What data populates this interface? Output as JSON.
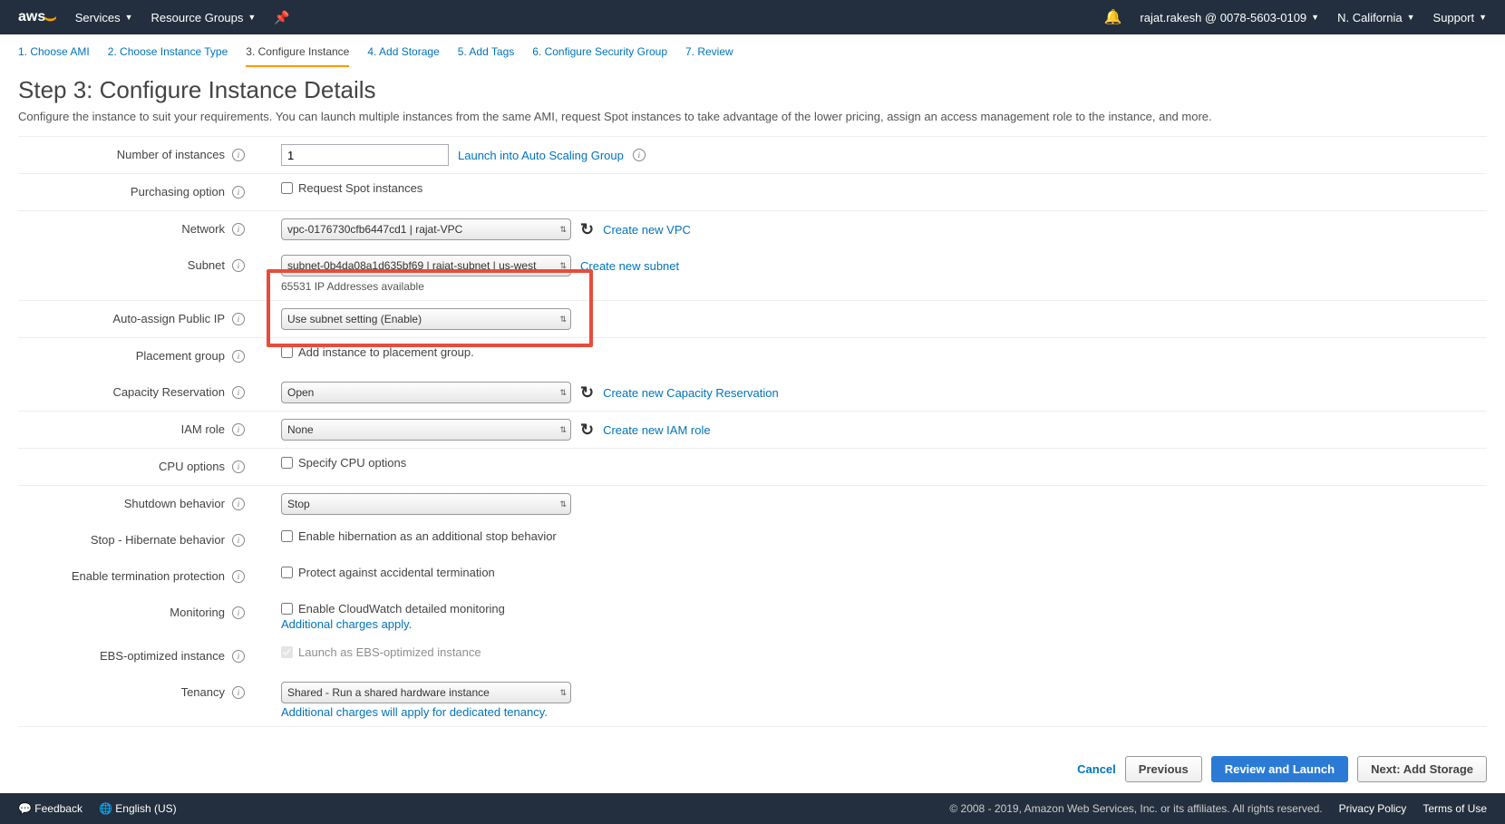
{
  "topnav": {
    "logo_text": "aws",
    "services": "Services",
    "resource_groups": "Resource Groups",
    "account": "rajat.rakesh @ 0078-5603-0109",
    "region": "N. California",
    "support": "Support"
  },
  "wizard": {
    "step1": "1. Choose AMI",
    "step2": "2. Choose Instance Type",
    "step3": "3. Configure Instance",
    "step4": "4. Add Storage",
    "step5": "5. Add Tags",
    "step6": "6. Configure Security Group",
    "step7": "7. Review"
  },
  "page": {
    "title": "Step 3: Configure Instance Details",
    "subtitle": "Configure the instance to suit your requirements. You can launch multiple instances from the same AMI, request Spot instances to take advantage of the lower pricing, assign an access management role to the instance, and more."
  },
  "labels": {
    "num_instances": "Number of instances",
    "purchasing": "Purchasing option",
    "network": "Network",
    "subnet": "Subnet",
    "auto_assign": "Auto-assign Public IP",
    "placement": "Placement group",
    "capacity": "Capacity Reservation",
    "iam": "IAM role",
    "cpu": "CPU options",
    "shutdown": "Shutdown behavior",
    "hibernate": "Stop - Hibernate behavior",
    "termination": "Enable termination protection",
    "monitoring": "Monitoring",
    "ebs": "EBS-optimized instance",
    "tenancy": "Tenancy"
  },
  "values": {
    "num_instances": "1",
    "asg_link": "Launch into Auto Scaling Group",
    "spot_label": "Request Spot instances",
    "network_selected": "vpc-0176730cfb6447cd1 | rajat-VPC",
    "create_vpc": "Create new VPC",
    "subnet_selected": "subnet-0b4da08a1d635bf69 | rajat-subnet | us-west",
    "subnet_note": "65531 IP Addresses available",
    "create_subnet": "Create new subnet",
    "auto_assign_selected": "Use subnet setting (Enable)",
    "placement_label": "Add instance to placement group.",
    "capacity_selected": "Open",
    "create_capacity": "Create new Capacity Reservation",
    "iam_selected": "None",
    "create_iam": "Create new IAM role",
    "cpu_label": "Specify CPU options",
    "shutdown_selected": "Stop",
    "hibernate_label": "Enable hibernation as an additional stop behavior",
    "termination_label": "Protect against accidental termination",
    "monitoring_label": "Enable CloudWatch detailed monitoring",
    "monitoring_note": "Additional charges apply.",
    "ebs_label": "Launch as EBS-optimized instance",
    "tenancy_selected": "Shared - Run a shared hardware instance",
    "tenancy_note": "Additional charges will apply for dedicated tenancy."
  },
  "buttons": {
    "cancel": "Cancel",
    "previous": "Previous",
    "review": "Review and Launch",
    "next": "Next: Add Storage"
  },
  "footer": {
    "feedback": "Feedback",
    "language": "English (US)",
    "copyright": "© 2008 - 2019, Amazon Web Services, Inc. or its affiliates. All rights reserved.",
    "privacy": "Privacy Policy",
    "terms": "Terms of Use"
  }
}
